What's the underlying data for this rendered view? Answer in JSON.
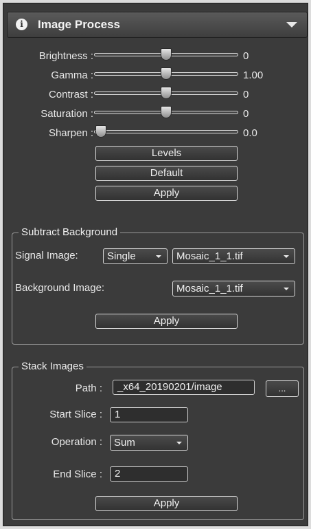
{
  "header": {
    "title": "Image Process"
  },
  "adjustments": [
    {
      "label": "Brightness :",
      "value": "0",
      "level": 0.5
    },
    {
      "label": "Gamma :",
      "value": "1.00",
      "level": 0.5
    },
    {
      "label": "Contrast :",
      "value": "0",
      "level": 0.5
    },
    {
      "label": "Saturation :",
      "value": "0",
      "level": 0.5
    },
    {
      "label": "Sharpen :",
      "value": "0.0",
      "level": 0.0
    }
  ],
  "buttons": {
    "levels": "Levels",
    "default": "Default",
    "apply": "Apply"
  },
  "subtract_background": {
    "title": "Subtract Background",
    "signal_label": "Signal Image:",
    "signal_mode": "Single",
    "signal_file": "Mosaic_1_1.tif",
    "background_label": "Background Image:",
    "background_file": "Mosaic_1_1.tif",
    "apply": "Apply"
  },
  "stack_images": {
    "title": "Stack Images",
    "path_label": "Path :",
    "path_value": "_x64_20190201/image",
    "browse": "...",
    "start_label": "Start Slice :",
    "start_value": "1",
    "operation_label": "Operation :",
    "operation_value": "Sum",
    "end_label": "End Slice :",
    "end_value": "2",
    "apply": "Apply"
  }
}
